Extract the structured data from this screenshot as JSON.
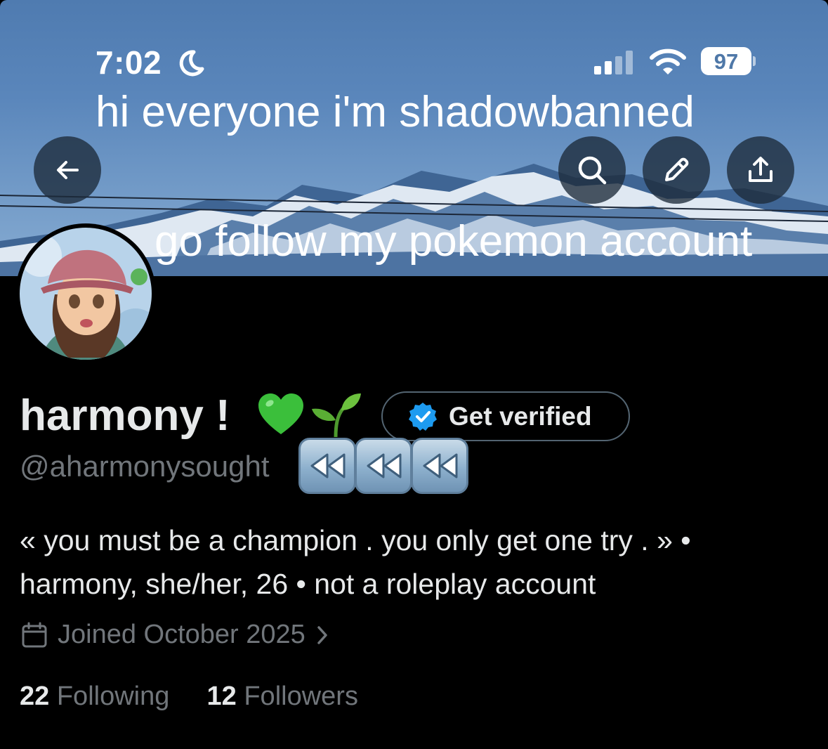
{
  "status_bar": {
    "time": "7:02",
    "battery_level": "97",
    "icons": [
      "moon-icon",
      "cellular-signal-icon",
      "wifi-icon",
      "battery-icon"
    ]
  },
  "banner": {
    "overlay_line_1": "hi everyone i'm shadowbanned",
    "overlay_line_2": "go follow my pokemon account"
  },
  "header_actions": {
    "icons": [
      "back-arrow-icon",
      "search-icon",
      "pencil-icon",
      "share-icon"
    ]
  },
  "profile": {
    "display_name": "harmony !",
    "name_emojis": [
      "green-heart",
      "seedling"
    ],
    "handle": "@aharmonysought",
    "handle_emojis": [
      "rewind",
      "rewind",
      "rewind"
    ],
    "get_verified_label": "Get verified",
    "bio_line_1": "« you must be a champion . you only get one try . » •",
    "bio_line_2": "harmony, she/her, 26 • not a roleplay account",
    "joined": "Joined October 2025",
    "following_count": "22",
    "following_label": "Following",
    "followers_count": "12",
    "followers_label": "Followers"
  },
  "colors": {
    "background": "#000000",
    "primary_text": "#e7e9ea",
    "secondary_text": "#71767b",
    "verified_blue": "#1d9bf0",
    "button_border": "#536471"
  }
}
